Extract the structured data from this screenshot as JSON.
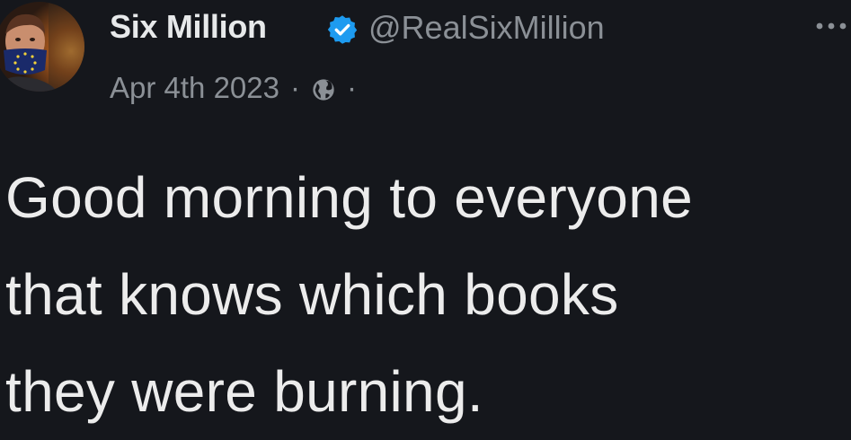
{
  "author": {
    "display_name": "Six Million",
    "handle": "@RealSixMillion",
    "verified": true,
    "avatar_icon": "profile-photo-avatar"
  },
  "meta": {
    "date": "Apr 4th 2023",
    "separator": "·",
    "visibility_icon": "globe-icon"
  },
  "post": {
    "lines": [
      "Good morning to everyone",
      "that knows which books",
      "they were burning."
    ]
  },
  "menu": {
    "more_icon": "more-options-icon"
  },
  "colors": {
    "background": "#15171c",
    "text_primary": "#e7e9ea",
    "text_secondary": "#8b9096",
    "verified_blue": "#1d9bf0"
  }
}
